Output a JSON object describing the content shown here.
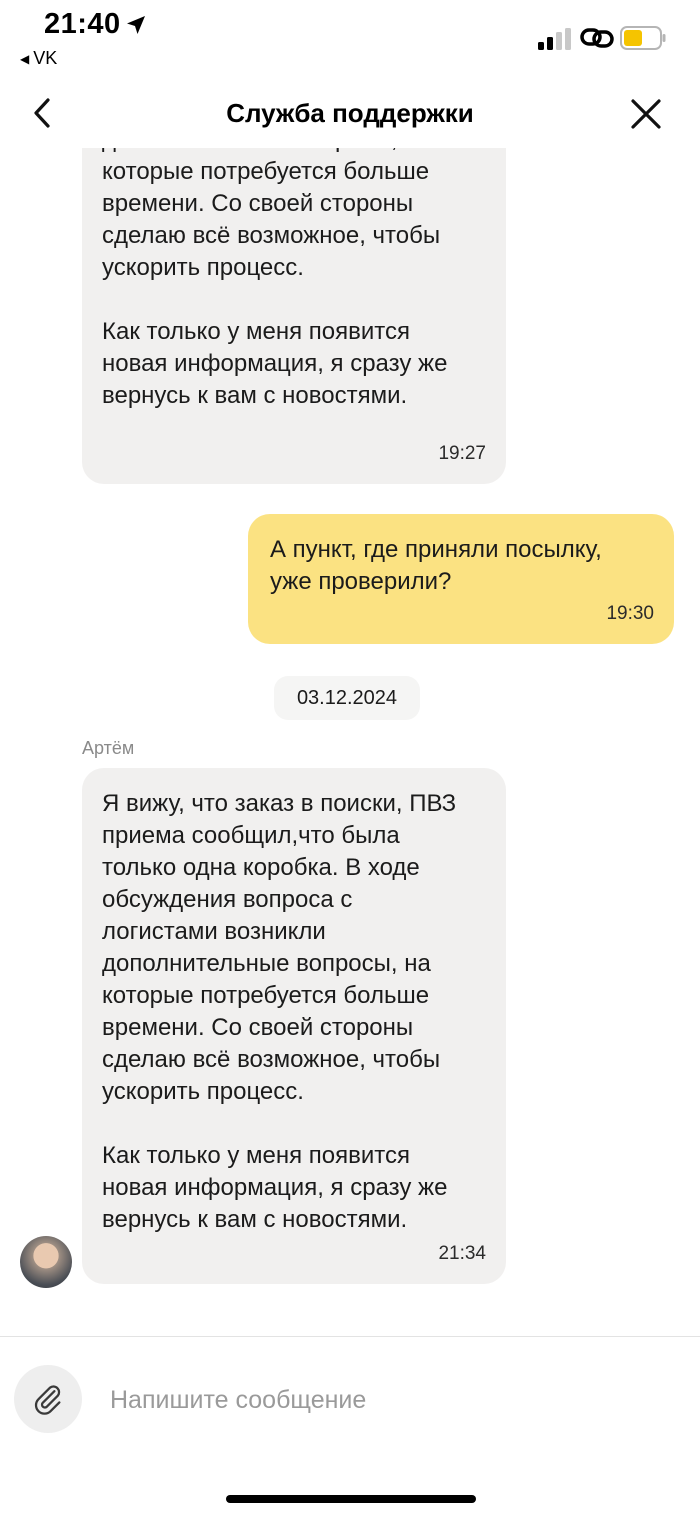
{
  "status_bar": {
    "time": "21:40",
    "back_app": "VK",
    "icons": [
      "location-arrow-icon",
      "signal-icon",
      "link-icon",
      "battery-icon"
    ],
    "battery_color": "#f5c400"
  },
  "header": {
    "title": "Служба поддержки",
    "back_icon": "chevron-left-icon",
    "close_icon": "close-icon"
  },
  "messages": [
    {
      "direction": "incoming",
      "text": "дополнительные вопросы, на\nкоторые потребуется больше\nвремени. Со своей стороны\nсделаю всё возможное, чтобы\nускорить процесс.\n\nКак только у меня появится\nновая информация, я сразу же\nвернусь к вам с новостями.",
      "time": "19:27"
    },
    {
      "direction": "outgoing",
      "text": "А пункт, где приняли посылку,\nуже проверили?",
      "time": "19:30"
    },
    {
      "direction": "incoming",
      "sender": "Артём",
      "text": "Я вижу, что заказ в поиски, ПВЗ\nприема сообщил,что была\nтолько одна коробка. В ходе\nобсуждения вопроса с\nлогистами возникли\nдополнительные вопросы, на\nкоторые потребуется больше\nвремени. Со своей стороны\nсделаю всё возможное, чтобы\nускорить процесс.\n\nКак только у меня появится\nновая информация, я сразу же\nвернусь к вам с новостями.",
      "time": "21:34"
    }
  ],
  "date_separator": "03.12.2024",
  "composer": {
    "placeholder": "Напишите сообщение",
    "value": "",
    "attach_icon": "paperclip-icon"
  },
  "colors": {
    "outgoing_bubble": "#fbe282",
    "incoming_bubble": "#f1f0ef"
  }
}
